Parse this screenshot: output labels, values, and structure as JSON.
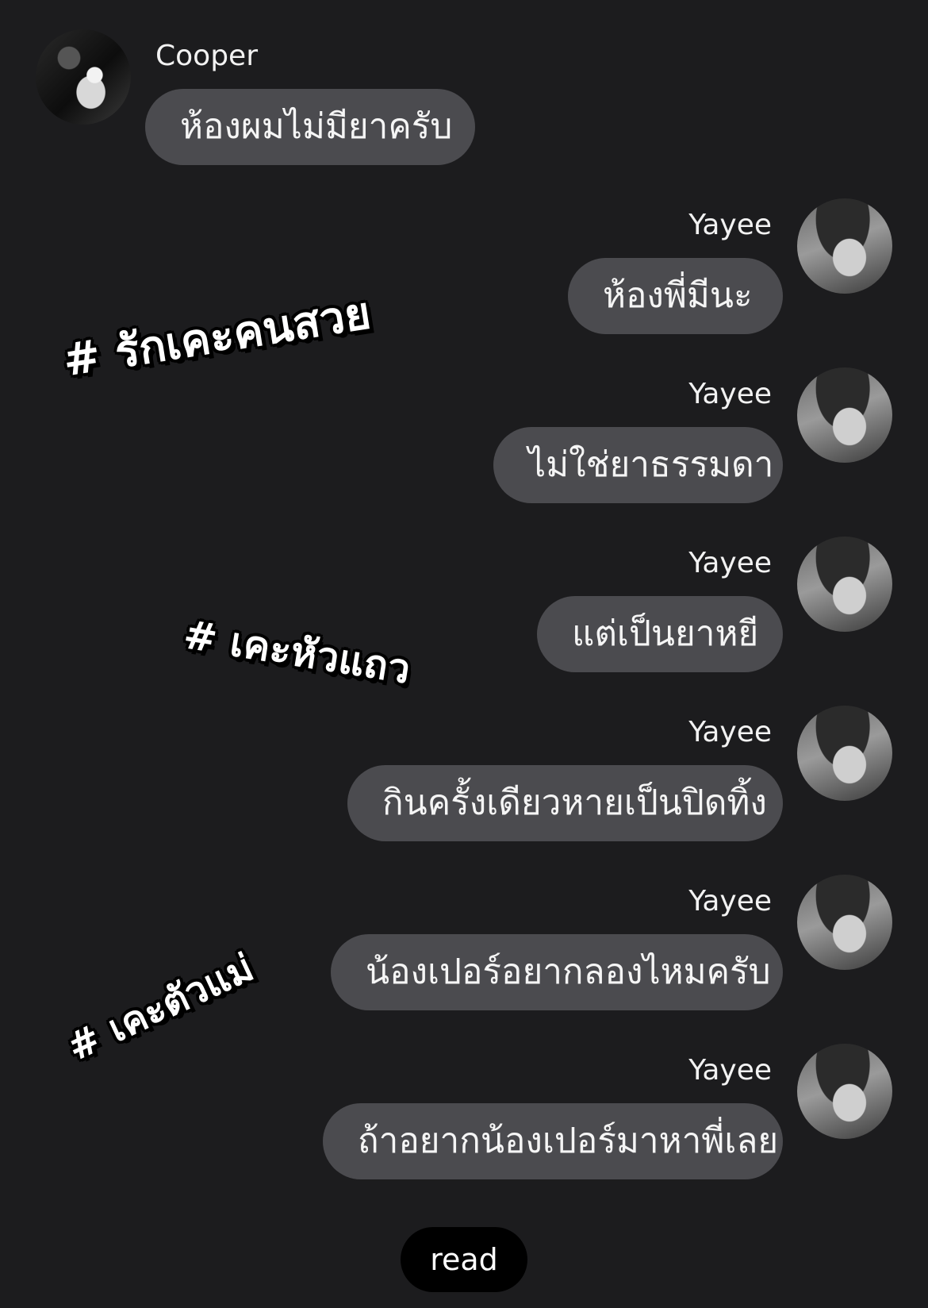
{
  "conversation": {
    "first_message": {
      "sender": "Cooper",
      "text": "ห้องผมไม่มียาครับ"
    },
    "messages": [
      {
        "sender": "Yayee",
        "text": "ห้องพี่มีนะ"
      },
      {
        "sender": "Yayee",
        "text": "ไม่ใช่ยาธรรมดา"
      },
      {
        "sender": "Yayee",
        "text": "แต่เป็นยาหยี"
      },
      {
        "sender": "Yayee",
        "text": "กินครั้งเดียวหายเป็นปิดทิ้ง"
      },
      {
        "sender": "Yayee",
        "text": "น้องเปอร์อยากลองไหมครับ"
      },
      {
        "sender": "Yayee",
        "text": "ถ้าอยากน้องเปอร์มาหาพี่เลย"
      }
    ]
  },
  "hashtags": [
    "# รักเคะคนสวย",
    "# เคะหัวแถว",
    "# เคะตัวแม่"
  ],
  "status": {
    "read_label": "read"
  },
  "colors": {
    "background": "#1c1c1e",
    "bubble": "#4b4b4f",
    "read_pill": "#000000"
  }
}
